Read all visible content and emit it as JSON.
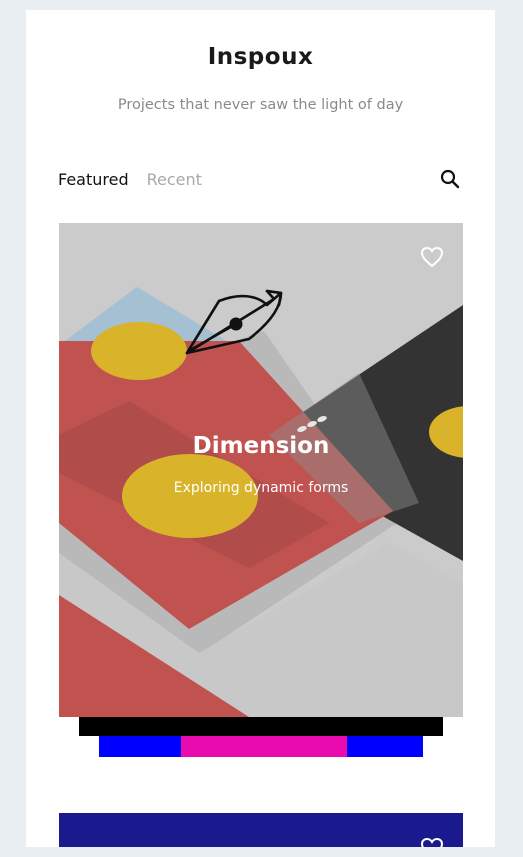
{
  "app": {
    "title": "Inspoux",
    "subtitle": "Projects that never saw the light of day"
  },
  "tabs": [
    {
      "label": "Featured",
      "active": true
    },
    {
      "label": "Recent",
      "active": false
    }
  ],
  "icons": {
    "search": "search-icon",
    "favorite": "heart-icon"
  },
  "cards": [
    {
      "title": "Dimension",
      "description": "Exploring dynamic forms"
    }
  ],
  "colors": {
    "page_background": "#e9eef3",
    "card_background": "#cbcbcb",
    "shape_red": "#c0524f",
    "shape_blue": "#a5c0d2",
    "shape_yellow": "#d9b42a",
    "shape_dark": "#333333",
    "stack_black": "#000000",
    "stack_blue": "#0000ff",
    "stack_pink": "#ea0bb0",
    "second_card": "#1a1a8e"
  }
}
